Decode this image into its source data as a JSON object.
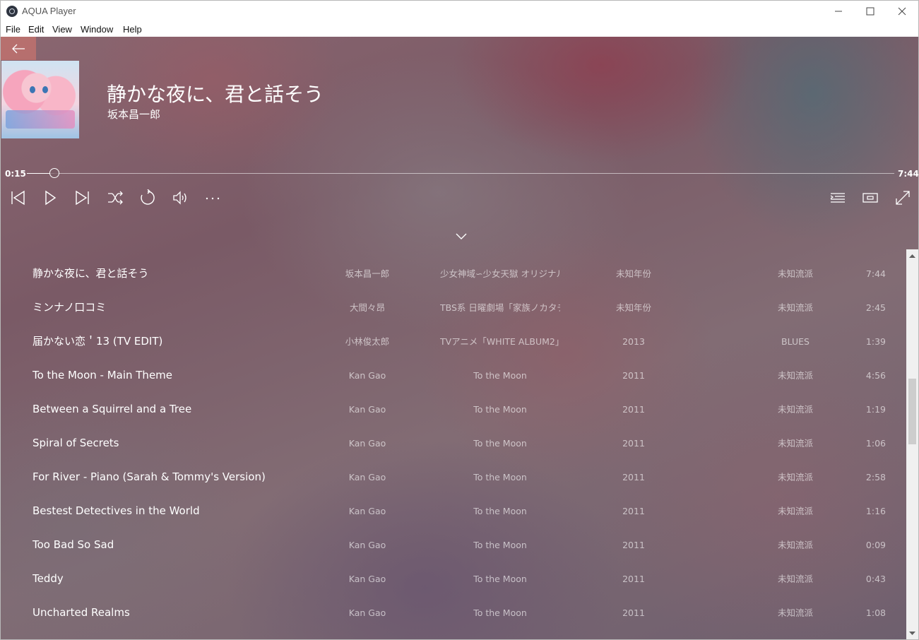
{
  "window": {
    "title": "AQUA Player"
  },
  "menu": [
    "File",
    "Edit",
    "View",
    "Window",
    "Help"
  ],
  "now_playing": {
    "title": "静かな夜に、君と話そう",
    "artist": "坂本昌一郎",
    "current_time": "0:15",
    "total_time": "7:44",
    "progress": 0.032
  },
  "icons": {
    "back": "arrow-left-icon",
    "prev": "skip-back-icon",
    "play": "play-icon",
    "next": "skip-forward-icon",
    "shuffle": "shuffle-icon",
    "repeat": "repeat-icon",
    "volume": "volume-icon",
    "more": "more-icon",
    "playlist": "playlist-icon",
    "miniplayer": "miniplayer-icon",
    "fullscreen": "fullscreen-icon",
    "collapse": "chevron-down-icon"
  },
  "tracks": [
    {
      "title": "静かな夜に、君と話そう",
      "artist": "坂本昌一郎",
      "album": "少女神域∽少女天獄 オリジナル",
      "year": "未知年份",
      "genre": "未知流派",
      "duration": "7:44"
    },
    {
      "title": "ミンナノ口コミ",
      "artist": "大間々昂",
      "album": "TBS系 日曜劇場「家族ノカタチ",
      "year": "未知年份",
      "genre": "未知流派",
      "duration": "2:45"
    },
    {
      "title": "届かない恋＇13 (TV EDIT)",
      "artist": "小林俊太郎",
      "album": "TVアニメ「WHITE ALBUM2」(",
      "year": "2013",
      "genre": "BLUES",
      "duration": "1:39"
    },
    {
      "title": "To the Moon - Main Theme",
      "artist": "Kan Gao",
      "album": "To the Moon",
      "year": "2011",
      "genre": "未知流派",
      "duration": "4:56"
    },
    {
      "title": "Between a Squirrel and a Tree",
      "artist": "Kan Gao",
      "album": "To the Moon",
      "year": "2011",
      "genre": "未知流派",
      "duration": "1:19"
    },
    {
      "title": "Spiral of Secrets",
      "artist": "Kan Gao",
      "album": "To the Moon",
      "year": "2011",
      "genre": "未知流派",
      "duration": "1:06"
    },
    {
      "title": "For River - Piano (Sarah & Tommy's Version)",
      "artist": "Kan Gao",
      "album": "To the Moon",
      "year": "2011",
      "genre": "未知流派",
      "duration": "2:58"
    },
    {
      "title": "Bestest Detectives in the World",
      "artist": "Kan Gao",
      "album": "To the Moon",
      "year": "2011",
      "genre": "未知流派",
      "duration": "1:16"
    },
    {
      "title": "Too Bad So Sad",
      "artist": "Kan Gao",
      "album": "To the Moon",
      "year": "2011",
      "genre": "未知流派",
      "duration": "0:09"
    },
    {
      "title": "Teddy",
      "artist": "Kan Gao",
      "album": "To the Moon",
      "year": "2011",
      "genre": "未知流派",
      "duration": "0:43"
    },
    {
      "title": "Uncharted Realms",
      "artist": "Kan Gao",
      "album": "To the Moon",
      "year": "2011",
      "genre": "未知流派",
      "duration": "1:08"
    }
  ]
}
